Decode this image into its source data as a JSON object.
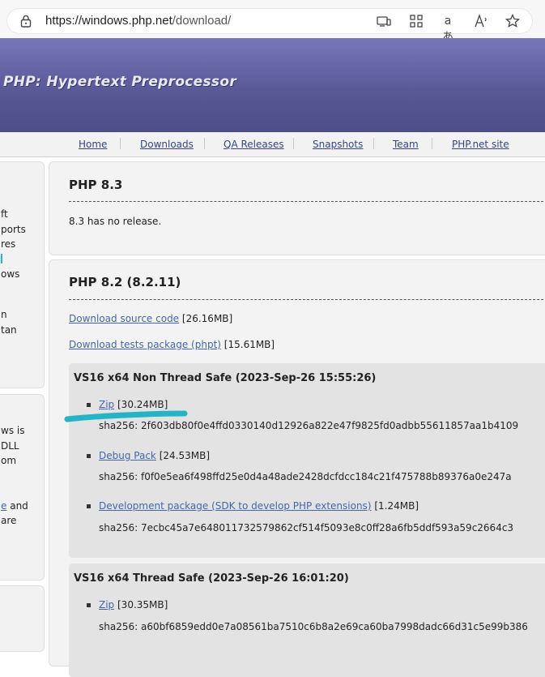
{
  "browser": {
    "url_host": "https://windows.php.net",
    "url_path": "/download/",
    "icons": [
      "lock-icon",
      "screen-cast-icon",
      "apps-icon",
      "translate-icon",
      "read-aloud-icon",
      "favorite-star-icon"
    ]
  },
  "header": {
    "title": "PHP: Hypertext Preprocessor"
  },
  "nav": {
    "items": [
      "Home",
      "Downloads",
      "QA Releases",
      "Snapshots",
      "Team",
      "PHP.net site"
    ]
  },
  "sidebar": {
    "box1_lines": [
      "ft",
      "ports",
      "res",
      "",
      "ows",
      "",
      "n",
      "tan"
    ],
    "box2_lines": [
      "ws is",
      "DLL",
      "om",
      "",
      "e",
      "and",
      "are"
    ]
  },
  "php83": {
    "title": "PHP 8.3",
    "note": "8.3 has no release."
  },
  "php82": {
    "title": "PHP 8.2 (8.2.11)",
    "source_label": "Download source code",
    "source_size": "[26.16MB]",
    "tests_label": "Download tests package (phpt)",
    "tests_size": "[15.61MB]",
    "builds": [
      {
        "title": "VS16 x64 Non Thread Safe (2023-Sep-26 15:55:26)",
        "items": [
          {
            "label": "Zip",
            "size": "[30.24MB]",
            "sha": "sha256: 2f603db80f0e4ffd0330140d12926a822e47f9825fd0adbb55611857aa1b4109"
          },
          {
            "label": "Debug Pack",
            "size": "[24.53MB]",
            "sha": "sha256: f0f0e5ea6f498ffd25e0d4a48ade2428dcfdcc184c21f475788b89376a0e247a"
          },
          {
            "label": "Development package (SDK to develop PHP extensions)",
            "size": "[1.24MB]",
            "sha": "sha256: 7ecbc45a7e648011732579862cf514f5093e8c0ff28a6fb5ddf593a59c2664c3"
          }
        ]
      },
      {
        "title": "VS16 x64 Thread Safe (2023-Sep-26 16:01:20)",
        "items": [
          {
            "label": "Zip",
            "size": "[30.35MB]",
            "sha": "sha256: a60bf6859edd0e7a08561ba7510c6b8a2e69ca60ba7998dadc66d31c5e99b386"
          }
        ]
      }
    ]
  },
  "colors": {
    "header_top": "#7777bb",
    "header_bottom": "#4e4e8a",
    "link": "#4466aa",
    "highlight_stroke": "#22b5c8"
  }
}
